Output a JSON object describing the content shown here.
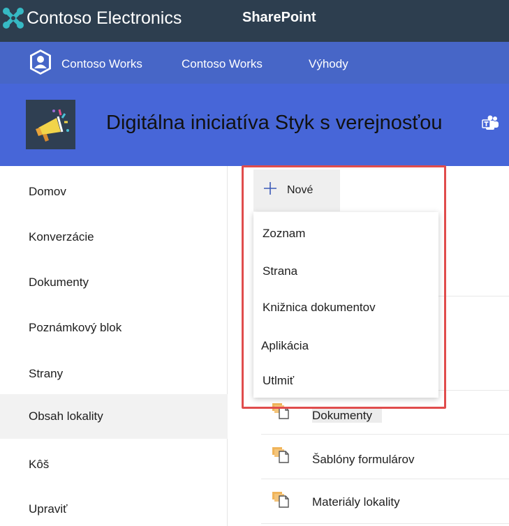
{
  "suite_bar": {
    "org_name": "Contoso Electronics",
    "app_name": "SharePoint",
    "icon": "waffle-logo-icon",
    "background": "#2d3e4f",
    "accent": "#36b9c4"
  },
  "hub_nav": {
    "logo_icon": "contoso-works-logo-icon",
    "links": [
      "Contoso Works",
      "Contoso Works",
      "Výhody"
    ],
    "background": "#4766c7"
  },
  "site_header": {
    "title": "Digitálna iniciatíva  Styk s verejnosťou",
    "logo_icon": "megaphone-icon",
    "teams_icon": "teams-icon",
    "background": "#4766d8"
  },
  "left_nav": {
    "items": [
      {
        "label": "Domov"
      },
      {
        "label": "Konverzácie"
      },
      {
        "label": "Dokumenty"
      },
      {
        "label": "Poznámkový blok"
      },
      {
        "label": "Strany"
      },
      {
        "label": "Obsah lokality",
        "selected": true
      },
      {
        "label": "Kôš"
      },
      {
        "label": "Upraviť"
      }
    ]
  },
  "command_bar": {
    "new_label": "Nové",
    "new_icon": "plus-icon"
  },
  "new_menu": {
    "items": [
      "Zoznam",
      "Strana",
      "Knižnica dokumentov",
      "Aplikácia",
      "Utlmiť"
    ]
  },
  "content_list": {
    "icon": "document-library-icon",
    "items": [
      "Dokumenty",
      "Šablóny formulárov",
      "Materiály lokality"
    ]
  },
  "highlight_color": "#e04c4c"
}
